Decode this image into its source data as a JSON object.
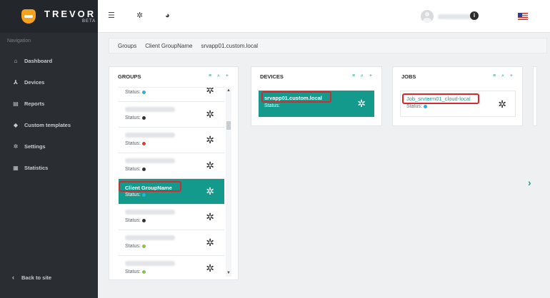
{
  "brand": {
    "title": "TREVOR",
    "beta": "BETA"
  },
  "sidebar": {
    "nav_label": "Navigation",
    "items": [
      {
        "label": "Dashboard",
        "icon": "home-icon"
      },
      {
        "label": "Devices",
        "icon": "sitemap-icon"
      },
      {
        "label": "Reports",
        "icon": "list-icon"
      },
      {
        "label": "Custom templates",
        "icon": "tag-icon"
      },
      {
        "label": "Settings",
        "icon": "gear-icon"
      },
      {
        "label": "Statistics",
        "icon": "table-icon"
      }
    ],
    "back_label": "Back to site"
  },
  "header": {
    "info_glyph": "i"
  },
  "breadcrumb": [
    "Groups",
    "Client GroupName",
    "srvapp01.custom.local"
  ],
  "panels": {
    "groups": {
      "title": "GROUPS",
      "tools": "≡ ⌕ +"
    },
    "devices": {
      "title": "DEVICES",
      "tools": "≡ ⌕ +"
    },
    "jobs": {
      "title": "JOBS",
      "tools": "≡ ⌕ +"
    }
  },
  "groups": {
    "status_label": "Status:",
    "items": [
      {
        "name": "",
        "status_color": "#1fb6d8"
      },
      {
        "name": "",
        "status_color": "#333333"
      },
      {
        "name": "",
        "status_color": "#e53935"
      },
      {
        "name": "",
        "status_color": "#333333"
      },
      {
        "name": "Client GroupName",
        "status_color": "#1fb6d8",
        "selected": true
      },
      {
        "name": "",
        "status_color": "#333333"
      },
      {
        "name": "",
        "status_color": "#8bc34a"
      },
      {
        "name": "",
        "status_color": "#8bc34a"
      }
    ]
  },
  "devices": {
    "name": "srvapp01.custom.local",
    "status_label": "Status:"
  },
  "jobs": {
    "name": "Job_srvterm01_cloud-local",
    "status_label": "Status:",
    "status_color": "#1fb6d8"
  },
  "colors": {
    "accent": "#139a8c",
    "highlight": "#d9272e"
  }
}
